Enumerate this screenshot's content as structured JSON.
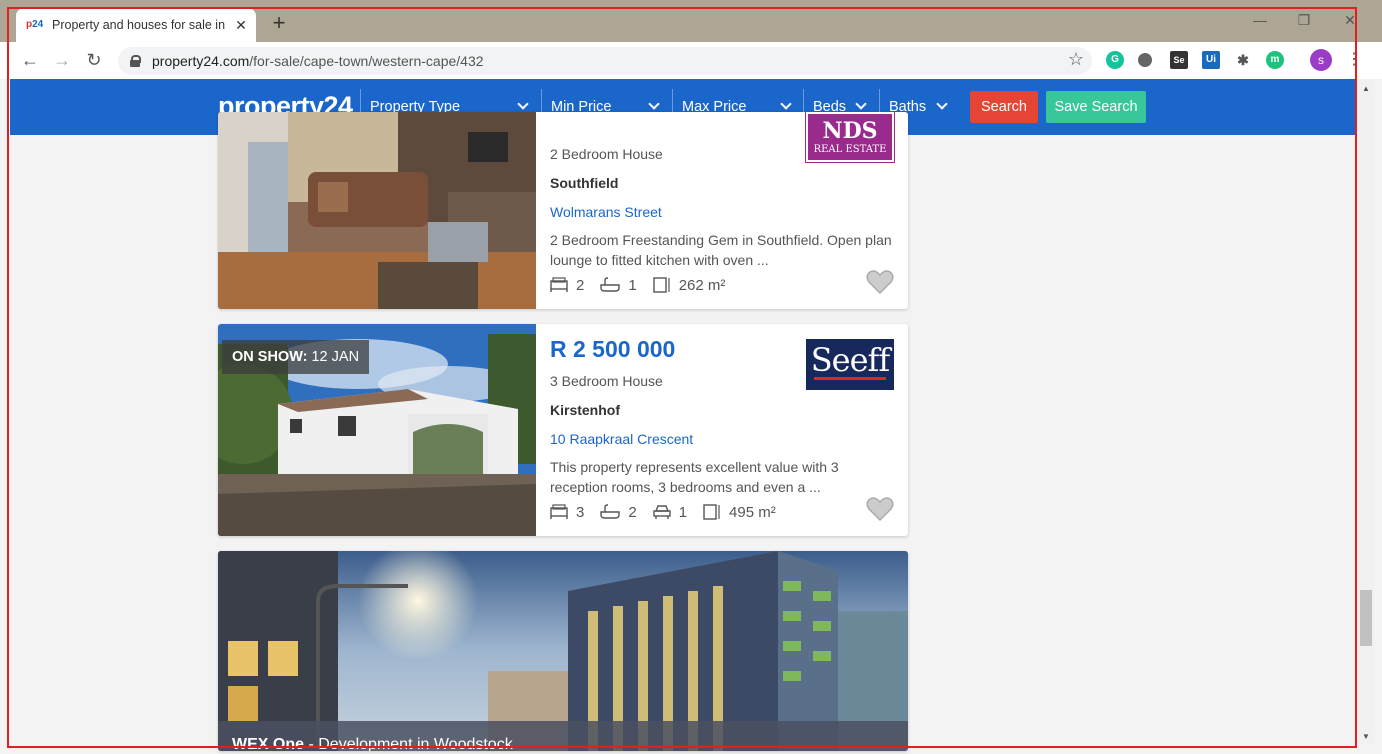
{
  "browser": {
    "tab_title": "Property and houses for sale in C",
    "tab_favicon_left": "p",
    "tab_favicon_right": "24",
    "close_glyph": "✕",
    "new_tab_glyph": "+",
    "url_host": "property24.com",
    "url_path": "/for-sale/cape-town/western-cape/432",
    "profile_initial": "s",
    "ext_se": "Se",
    "ext_ui": "Ui",
    "ext_m": "m"
  },
  "header": {
    "logo": "property24",
    "filters": [
      "Property Type",
      "Min Price",
      "Max Price",
      "Beds",
      "Baths"
    ],
    "search_label": "Search",
    "save_search_label": "Save Search"
  },
  "listings": [
    {
      "property_type": "2 Bedroom House",
      "suburb": "Southfield",
      "street": "Wolmarans Street",
      "description_1": "2 Bedroom Freestanding Gem in Southfield. Open plan",
      "description_2": "lounge to fitted kitchen with oven ...",
      "beds": "2",
      "baths": "1",
      "size": "262 m²",
      "agency_lines": [
        "NDS",
        "REAL ESTATE"
      ]
    },
    {
      "on_show_label": "ON SHOW:",
      "on_show_date": "12 JAN",
      "price": "R 2 500 000",
      "property_type": "3 Bedroom House",
      "suburb": "Kirstenhof",
      "street": "10 Raapkraal Crescent",
      "description_1": "This property represents excellent value with 3",
      "description_2": "reception rooms, 3 bedrooms and even a ...",
      "beds": "3",
      "baths": "2",
      "garages": "1",
      "size": "495 m²",
      "agency": "Seeff"
    },
    {
      "banner_title": "WEX One",
      "banner_sub": "Development in Woodstock"
    }
  ],
  "colors": {
    "brand_blue": "#1a66cb",
    "search_red": "#e64535",
    "save_green": "#37c79a"
  }
}
